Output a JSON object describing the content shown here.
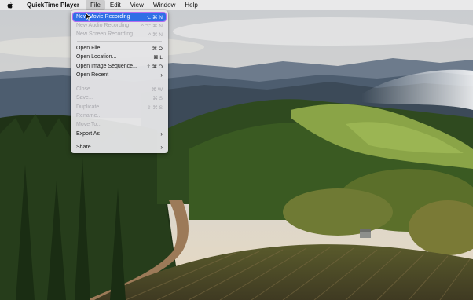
{
  "menubar": {
    "apple_icon": "apple-icon",
    "app_name": "QuickTime Player",
    "menus": [
      "File",
      "Edit",
      "View",
      "Window",
      "Help"
    ]
  },
  "file_menu": {
    "items": [
      {
        "label": "New Movie Recording",
        "shortcut": "⌥ ⌘ N",
        "state": "highlighted"
      },
      {
        "label": "New Audio Recording",
        "shortcut": "^ ⌥ ⌘ N",
        "state": "disabled"
      },
      {
        "label": "New Screen Recording",
        "shortcut": "^ ⌘ N",
        "state": "disabled"
      },
      {
        "label": "Open File...",
        "shortcut": "⌘ O",
        "state": "enabled"
      },
      {
        "label": "Open Location...",
        "shortcut": "⌘ L",
        "state": "enabled"
      },
      {
        "label": "Open Image Sequence...",
        "shortcut": "⇧ ⌘ O",
        "state": "enabled"
      },
      {
        "label": "Open Recent",
        "shortcut": "›",
        "state": "enabled"
      },
      {
        "label": "Close",
        "shortcut": "⌘ W",
        "state": "disabled"
      },
      {
        "label": "Save...",
        "shortcut": "⌘ S",
        "state": "disabled"
      },
      {
        "label": "Duplicate",
        "shortcut": "⇧ ⌘ S",
        "state": "disabled"
      },
      {
        "label": "Rename...",
        "shortcut": "",
        "state": "disabled"
      },
      {
        "label": "Move To...",
        "shortcut": "",
        "state": "disabled"
      },
      {
        "label": "Export As",
        "shortcut": "›",
        "state": "enabled"
      },
      {
        "label": "Share",
        "shortcut": "›",
        "state": "enabled"
      }
    ]
  },
  "colors": {
    "menu_highlight": "#2f6fe6",
    "highlight_outline": "#b46ef0",
    "disabled_text": "#a8a8ad"
  }
}
